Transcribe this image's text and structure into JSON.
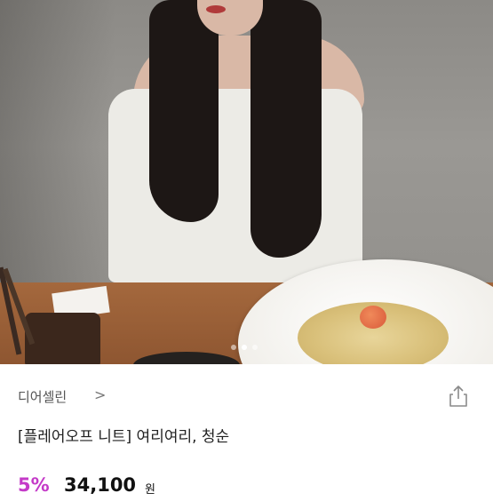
{
  "product": {
    "shop_name": "디어셀린",
    "shop_chevron": ">",
    "title": "[플레어오프 니트] 여리여리, 청순",
    "discount": "5%",
    "price": "34,100",
    "currency": "원"
  },
  "carousel": {
    "count": 3,
    "active_index": 1
  },
  "icons": {
    "share": "share-icon",
    "chevron": "chevron-right-icon"
  },
  "colors": {
    "discount": "#c43ac8",
    "price": "#111111",
    "shop": "#555555"
  }
}
